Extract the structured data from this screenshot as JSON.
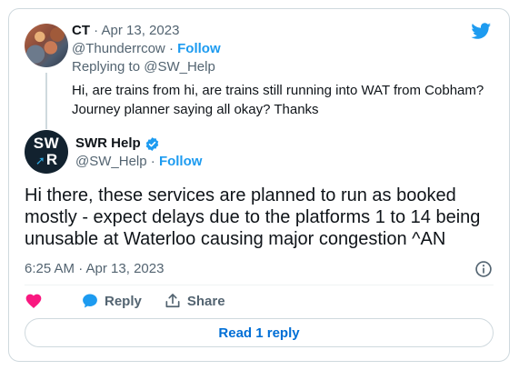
{
  "colors": {
    "accent": "#1d9bf0",
    "muted": "#536471",
    "text": "#0f1419",
    "heart": "#f91880",
    "swr_bg": "#12222f",
    "border": "#cfd9de"
  },
  "parent_tweet": {
    "display_name": "CT",
    "date": "Apr 13, 2023",
    "handle": "@Thunderrcow",
    "follow_label": "Follow",
    "replying_prefix": "Replying to ",
    "replying_to": "@SW_Help",
    "text": "Hi, are trains from hi, are trains still running into WAT from Cobham? Journey planner saying all okay? Thanks"
  },
  "main_tweet": {
    "avatar_top": "SW",
    "avatar_bottom": "R",
    "display_name": "SWR Help",
    "handle": "@SW_Help",
    "follow_label": "Follow",
    "text": "Hi there, these services are planned to run as booked mostly - expect delays due to the platforms 1 to 14 being unusable at Waterloo causing major congestion  ^AN",
    "timestamp": "6:25 AM · Apr 13, 2023"
  },
  "actions": {
    "reply_label": "Reply",
    "share_label": "Share"
  },
  "read_replies_label": "Read 1 reply",
  "icons": [
    "twitter-logo-icon",
    "verified-badge-icon",
    "info-icon",
    "heart-icon",
    "reply-bubble-icon",
    "share-icon"
  ]
}
